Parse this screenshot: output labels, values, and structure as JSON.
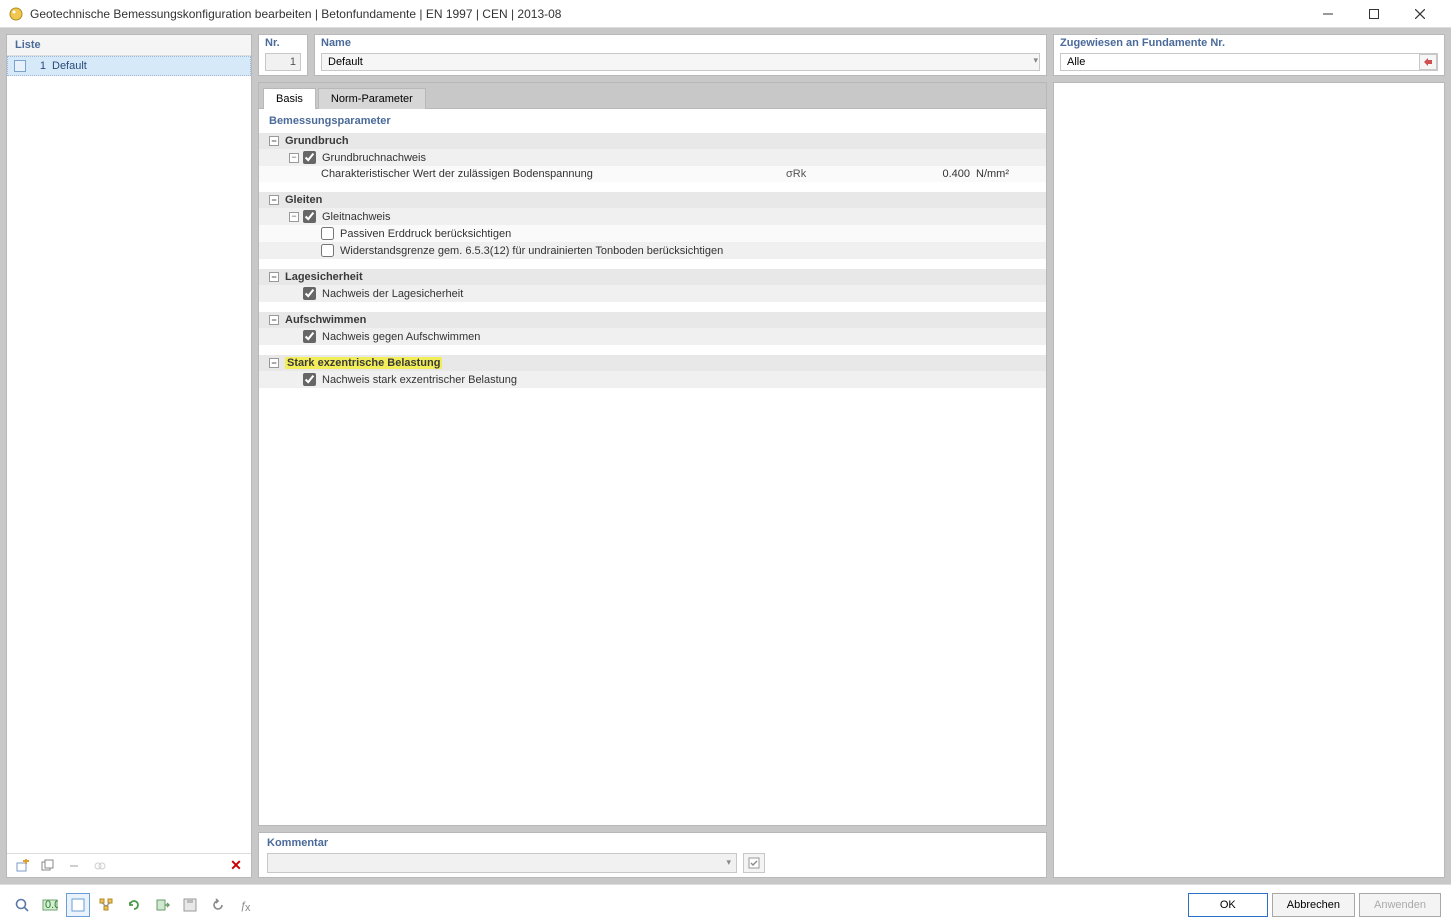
{
  "window": {
    "title": "Geotechnische Bemessungskonfiguration bearbeiten | Betonfundamente | EN 1997 | CEN | 2013-08"
  },
  "leftPanel": {
    "header": "Liste",
    "items": [
      {
        "num": "1",
        "name": "Default"
      }
    ]
  },
  "fields": {
    "nr": {
      "label": "Nr.",
      "value": "1"
    },
    "name": {
      "label": "Name",
      "value": "Default"
    },
    "assigned": {
      "label": "Zugewiesen an Fundamente Nr.",
      "value": "Alle"
    }
  },
  "tabs": {
    "basis": "Basis",
    "norm": "Norm-Parameter"
  },
  "section": {
    "title": "Bemessungsparameter",
    "groups": {
      "grundbruch": {
        "title": "Grundbruch",
        "proof": "Grundbruchnachweis",
        "char": "Charakteristischer Wert der zulässigen Bodenspannung",
        "sym": "σRk",
        "val": "0.400",
        "unit": "N/mm²"
      },
      "gleiten": {
        "title": "Gleiten",
        "proof": "Gleitnachweis",
        "passive": "Passiven Erddruck berücksichtigen",
        "resist": "Widerstandsgrenze gem. 6.5.3(12) für undrainierten Tonboden berücksichtigen"
      },
      "lage": {
        "title": "Lagesicherheit",
        "proof": "Nachweis der Lagesicherheit"
      },
      "aufschwimmen": {
        "title": "Aufschwimmen",
        "proof": "Nachweis gegen Aufschwimmen"
      },
      "exzentrisch": {
        "title": "Stark exzentrische Belastung",
        "proof": "Nachweis stark exzentrischer Belastung"
      }
    }
  },
  "comment": {
    "label": "Kommentar",
    "value": ""
  },
  "buttons": {
    "ok": "OK",
    "cancel": "Abbrechen",
    "apply": "Anwenden"
  }
}
